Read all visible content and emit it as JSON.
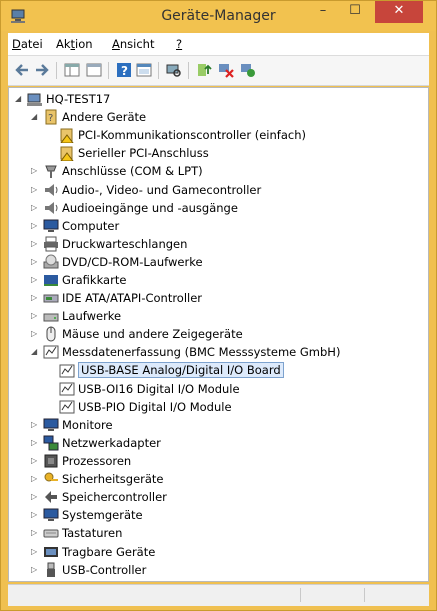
{
  "window": {
    "title": "Geräte-Manager",
    "minimize": "–",
    "maximize": "☐",
    "close": "✕"
  },
  "menu": [
    {
      "label": "Datei",
      "accel": "D",
      "rest": "atei"
    },
    {
      "label": "Aktion",
      "accel": "t",
      "pre": "Ak",
      "rest": "ion"
    },
    {
      "label": "Ansicht",
      "accel": "A",
      "rest": "nsicht"
    },
    {
      "label": "?",
      "accel": "?",
      "rest": ""
    }
  ],
  "toolbar": [
    "back-icon",
    "forward-icon",
    "properties-grid-icon",
    "console-tree-icon",
    "help-icon",
    "details-icon",
    "scan-hardware-icon",
    "update-driver-icon",
    "uninstall-icon",
    "enable-device-icon"
  ],
  "tree": [
    {
      "level": 0,
      "exp": "open",
      "icon": "computer-root",
      "label": "HQ-TEST17"
    },
    {
      "level": 1,
      "exp": "open",
      "icon": "unknown-device",
      "label": "Andere Geräte"
    },
    {
      "level": 2,
      "exp": "none",
      "icon": "warning-device",
      "label": "PCI-Kommunikationscontroller (einfach)"
    },
    {
      "level": 2,
      "exp": "none",
      "icon": "warning-device",
      "label": "Serieller PCI-Anschluss"
    },
    {
      "level": 1,
      "exp": "closed",
      "icon": "ports",
      "label": "Anschlüsse (COM & LPT)"
    },
    {
      "level": 1,
      "exp": "closed",
      "icon": "speaker",
      "label": "Audio-, Video- und Gamecontroller"
    },
    {
      "level": 1,
      "exp": "closed",
      "icon": "speaker",
      "label": "Audioeingänge und -ausgänge"
    },
    {
      "level": 1,
      "exp": "closed",
      "icon": "monitor",
      "label": "Computer"
    },
    {
      "level": 1,
      "exp": "closed",
      "icon": "printer",
      "label": "Druckwarteschlangen"
    },
    {
      "level": 1,
      "exp": "closed",
      "icon": "dvd",
      "label": "DVD/CD-ROM-Laufwerke"
    },
    {
      "level": 1,
      "exp": "closed",
      "icon": "display",
      "label": "Grafikkarte"
    },
    {
      "level": 1,
      "exp": "closed",
      "icon": "ide",
      "label": "IDE ATA/ATAPI-Controller"
    },
    {
      "level": 1,
      "exp": "closed",
      "icon": "drive",
      "label": "Laufwerke"
    },
    {
      "level": 1,
      "exp": "closed",
      "icon": "mouse",
      "label": "Mäuse und andere Zeigegeräte"
    },
    {
      "level": 1,
      "exp": "open",
      "icon": "daq",
      "label": "Messdatenerfassung (BMC Messsysteme GmbH)"
    },
    {
      "level": 2,
      "exp": "none",
      "icon": "daq",
      "label": "USB-BASE Analog/Digital I/O Board",
      "selected": true
    },
    {
      "level": 2,
      "exp": "none",
      "icon": "daq",
      "label": "USB-OI16 Digital I/O Module"
    },
    {
      "level": 2,
      "exp": "none",
      "icon": "daq",
      "label": "USB-PIO Digital I/O Module"
    },
    {
      "level": 1,
      "exp": "closed",
      "icon": "monitor",
      "label": "Monitore"
    },
    {
      "level": 1,
      "exp": "closed",
      "icon": "network",
      "label": "Netzwerkadapter"
    },
    {
      "level": 1,
      "exp": "closed",
      "icon": "cpu",
      "label": "Prozessoren"
    },
    {
      "level": 1,
      "exp": "closed",
      "icon": "security",
      "label": "Sicherheitsgeräte"
    },
    {
      "level": 1,
      "exp": "closed",
      "icon": "storage",
      "label": "Speichercontroller"
    },
    {
      "level": 1,
      "exp": "closed",
      "icon": "monitor",
      "label": "Systemgeräte"
    },
    {
      "level": 1,
      "exp": "closed",
      "icon": "keyboard",
      "label": "Tastaturen"
    },
    {
      "level": 1,
      "exp": "closed",
      "icon": "portable",
      "label": "Tragbare Geräte"
    },
    {
      "level": 1,
      "exp": "closed",
      "icon": "usb",
      "label": "USB-Controller"
    }
  ]
}
